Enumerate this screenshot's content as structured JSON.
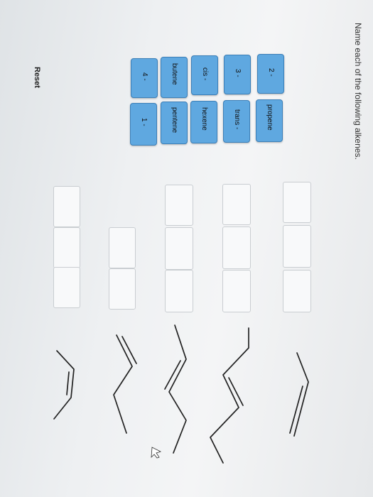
{
  "instruction": "Name each of the following alkenes.",
  "reset_label": "Reset",
  "tiles": {
    "t2": "2 -",
    "t3": "3 -",
    "cis": "cis -",
    "t4": "4 -",
    "propene": "propene",
    "trans": "trans -",
    "hexene": "hexene",
    "butene": "butene",
    "pentene": "pentene",
    "t1": "1 -"
  },
  "molecules": [
    "propene-structure",
    "trans-3-hexene-structure",
    "trans-2-pentene-structure",
    "1-butene-structure",
    "cis-2-butene-structure"
  ]
}
